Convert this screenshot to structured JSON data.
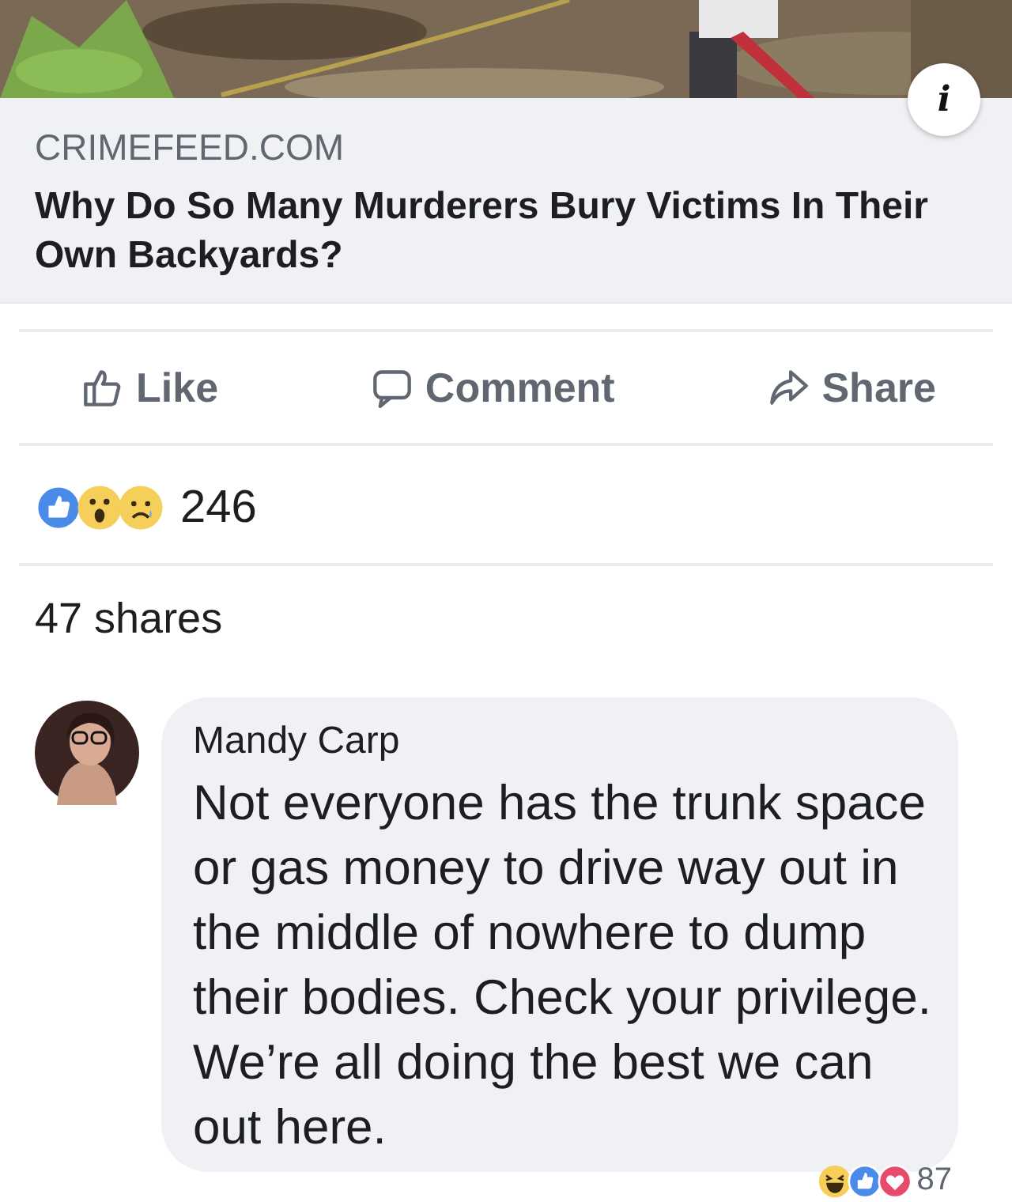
{
  "link_preview": {
    "info_button": "i",
    "source": "CRIMEFEED.COM",
    "headline": "Why Do So Many Murderers Bury Victims In Their Own Backyards?"
  },
  "actions": [
    {
      "kind": "like",
      "label": "Like"
    },
    {
      "kind": "comment",
      "label": "Comment"
    },
    {
      "kind": "share",
      "label": "Share"
    }
  ],
  "reactions": {
    "icons": [
      {
        "kind": "like"
      },
      {
        "kind": "wow"
      },
      {
        "kind": "sad"
      }
    ],
    "count": "246"
  },
  "shares": "47 shares",
  "comment": {
    "author": "Mandy Carp",
    "text": "Not everyone has the trunk space or gas money to drive way out in the middle of nowhere to dump their bodies. Check your privilege. We’re all doing the best we can out here.",
    "reactions": {
      "icons": [
        {
          "kind": "haha"
        },
        {
          "kind": "like"
        },
        {
          "kind": "love"
        }
      ],
      "count": "87"
    }
  }
}
